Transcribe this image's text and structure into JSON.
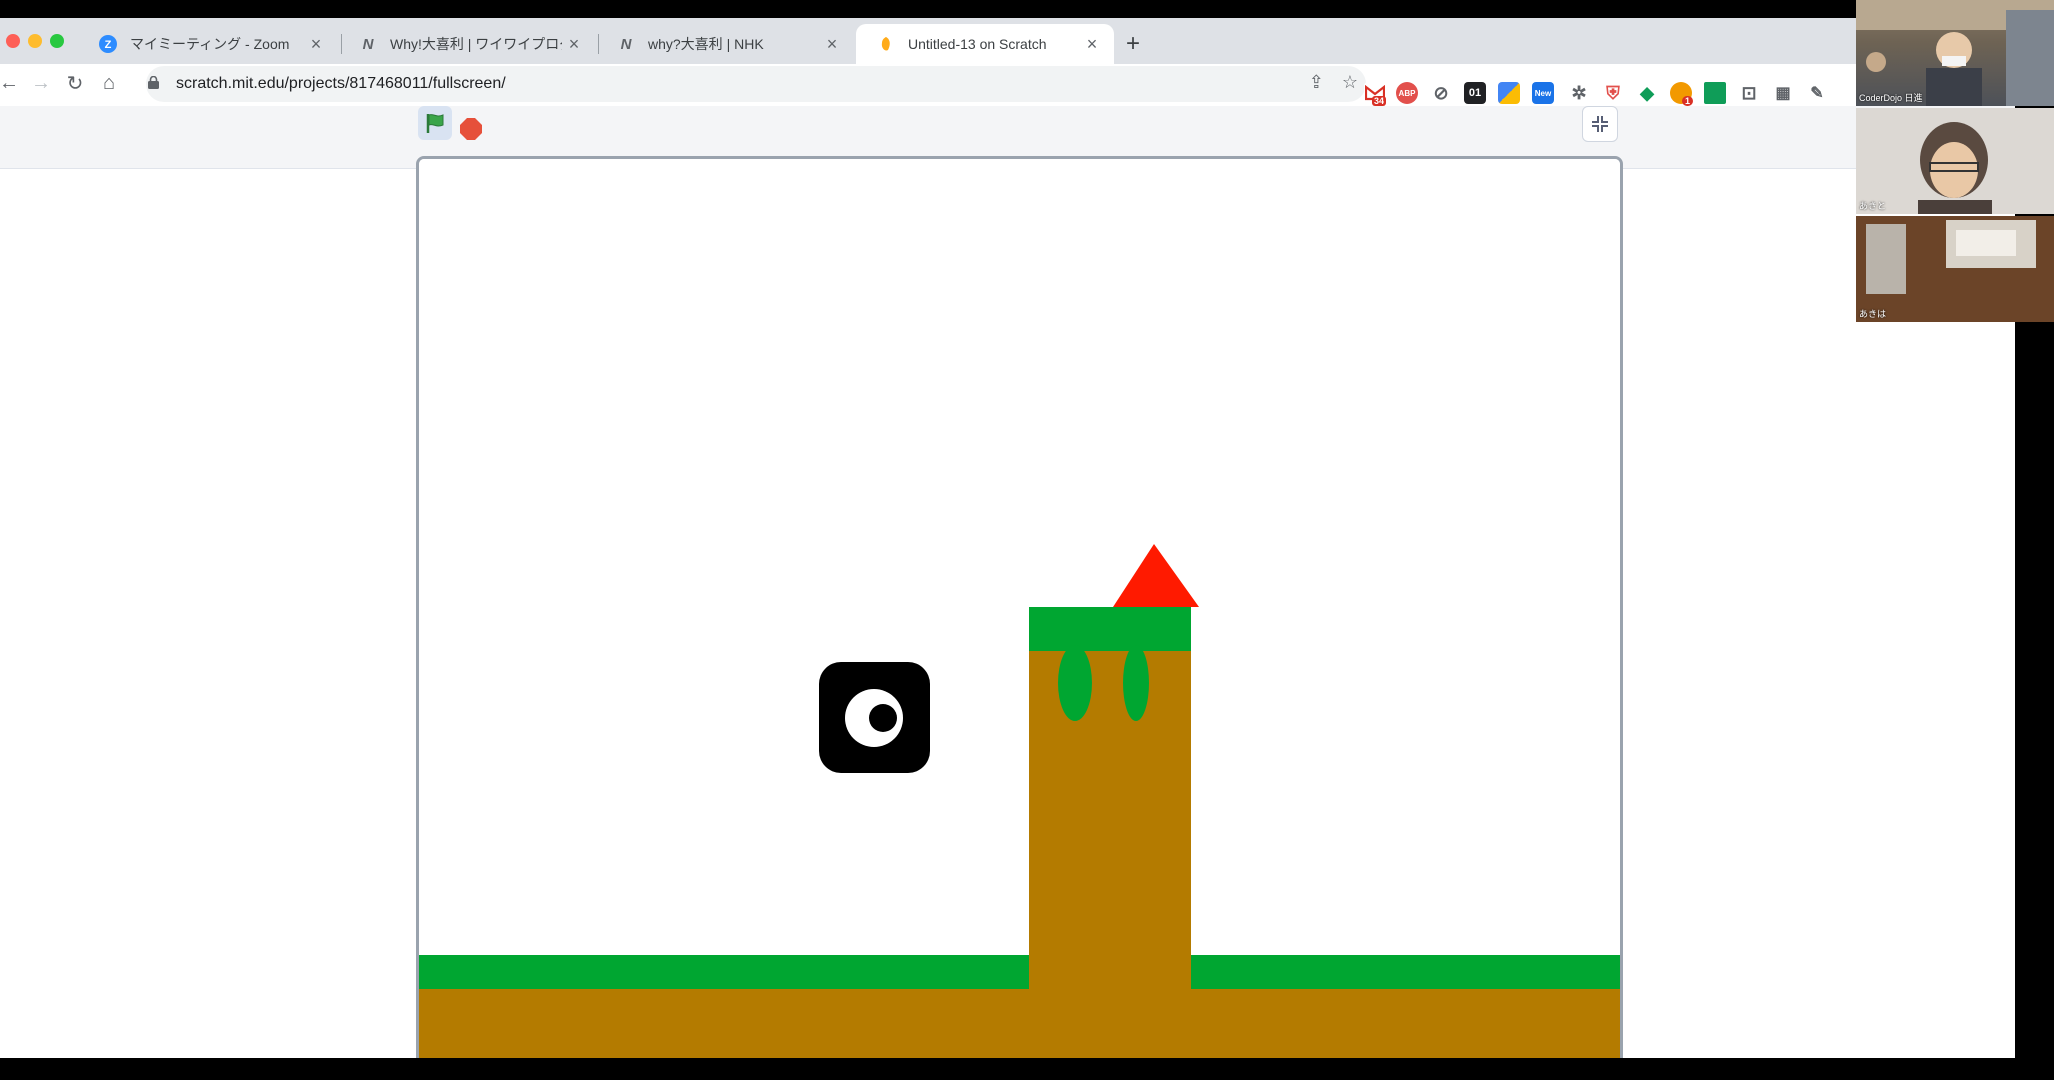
{
  "browser": {
    "tabs": [
      {
        "title": "マイミーティング - Zoom",
        "favicon": "zoom-icon",
        "active": false
      },
      {
        "title": "Why!大喜利 | ワイワイプログラミ",
        "favicon": "nhk-n-icon",
        "active": false
      },
      {
        "title": "why?大喜利 | NHK",
        "favicon": "nhk-n-icon",
        "active": false
      },
      {
        "title": "Untitled-13 on Scratch",
        "favicon": "scratch-icon",
        "active": true
      }
    ],
    "close_glyph": "×",
    "new_tab_glyph": "+",
    "url": "scratch.mit.edu/projects/817468011/fullscreen/",
    "extensions_badges": {
      "gmail": "34",
      "new": "New",
      "one": "01",
      "count": "1"
    }
  },
  "zoom_participants": [
    {
      "name": "CoderDojo 日進"
    },
    {
      "name": "あきと"
    },
    {
      "name": "あきは"
    }
  ],
  "colors": {
    "stage_grass": "#00a631",
    "stage_dirt": "#b47b00",
    "triangle": "#ff1a00",
    "flag": "#3aa54a",
    "stop": "#e6503a"
  }
}
